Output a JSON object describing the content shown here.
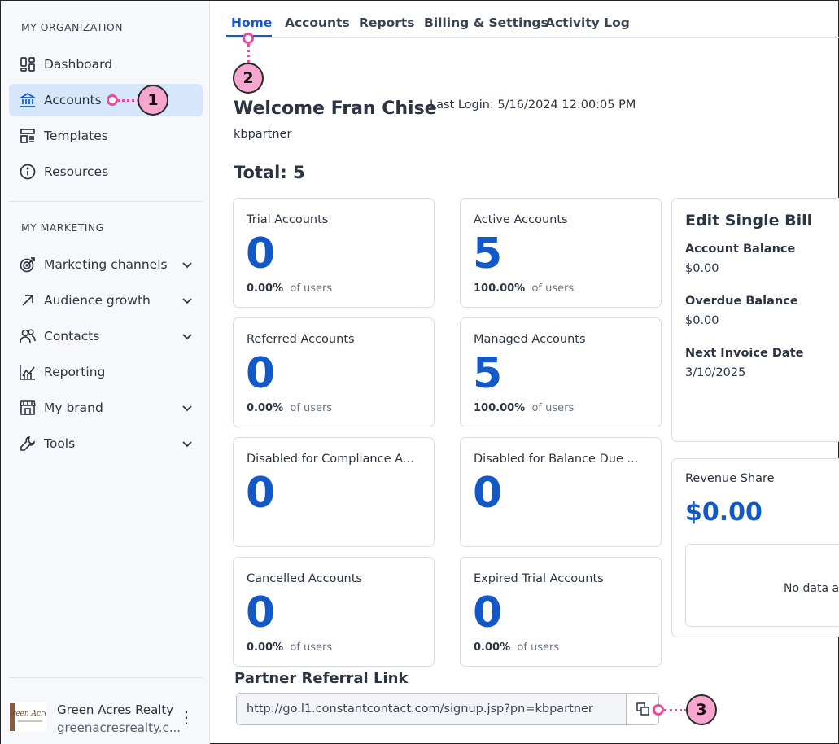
{
  "sidebar": {
    "section_org": "MY ORGANIZATION",
    "section_marketing": "MY MARKETING",
    "org_items": [
      {
        "label": "Dashboard",
        "icon": "dashboard-icon"
      },
      {
        "label": "Accounts",
        "icon": "bank-icon",
        "active": true
      },
      {
        "label": "Templates",
        "icon": "templates-icon"
      },
      {
        "label": "Resources",
        "icon": "info-icon"
      }
    ],
    "marketing_items": [
      {
        "label": "Marketing channels",
        "icon": "target-icon"
      },
      {
        "label": "Audience growth",
        "icon": "arrow-up-right-icon"
      },
      {
        "label": "Contacts",
        "icon": "people-icon"
      },
      {
        "label": "Reporting",
        "icon": "chart-icon"
      },
      {
        "label": "My brand",
        "icon": "storefront-icon"
      },
      {
        "label": "Tools",
        "icon": "wrench-icon"
      }
    ],
    "org_footer": {
      "name": "Green Acres Realty",
      "url": "greenacresrealty.c...",
      "logo_text": "Green Acres"
    }
  },
  "tabs": [
    "Home",
    "Accounts",
    "Reports",
    "Billing & Settings",
    "Activity Log"
  ],
  "welcome": {
    "title": "Welcome Fran Chise",
    "last_login": "Last Login: 5/16/2024 12:00:05 PM",
    "username": "kbpartner"
  },
  "total": "Total: 5",
  "of_users": "of users",
  "cards": [
    {
      "title": "Trial Accounts",
      "value": "0",
      "pct": "0.00%"
    },
    {
      "title": "Active Accounts",
      "value": "5",
      "pct": "100.00%"
    },
    {
      "title": "Referred Accounts",
      "value": "0",
      "pct": "0.00%"
    },
    {
      "title": "Managed Accounts",
      "value": "5",
      "pct": "100.00%"
    },
    {
      "title": "Disabled for Compliance A...",
      "value": "0",
      "pct": ""
    },
    {
      "title": "Disabled for Balance Due ...",
      "value": "0",
      "pct": ""
    },
    {
      "title": "Cancelled Accounts",
      "value": "0",
      "pct": "0.00%"
    },
    {
      "title": "Expired Trial Accounts",
      "value": "0",
      "pct": "0.00%"
    }
  ],
  "bill": {
    "title": "Edit Single Bill",
    "account_balance_label": "Account Balance",
    "account_balance": "$0.00",
    "overdue_balance_label": "Overdue Balance",
    "overdue_balance": "$0.00",
    "next_invoice_label": "Next Invoice Date",
    "next_invoice": "3/10/2025"
  },
  "revenue": {
    "title": "Revenue Share",
    "value": "$0.00",
    "no_data": "No data av"
  },
  "referral": {
    "title": "Partner Referral Link",
    "url": "http://go.l1.constantcontact.com/signup.jsp?pn=kbpartner"
  },
  "callouts": [
    "1",
    "2",
    "3"
  ],
  "colors": {
    "accent": "#1358c7",
    "callout": "#f7a7cf",
    "callout_line": "#e94d9a",
    "active_nav": "#d6e6fb"
  }
}
